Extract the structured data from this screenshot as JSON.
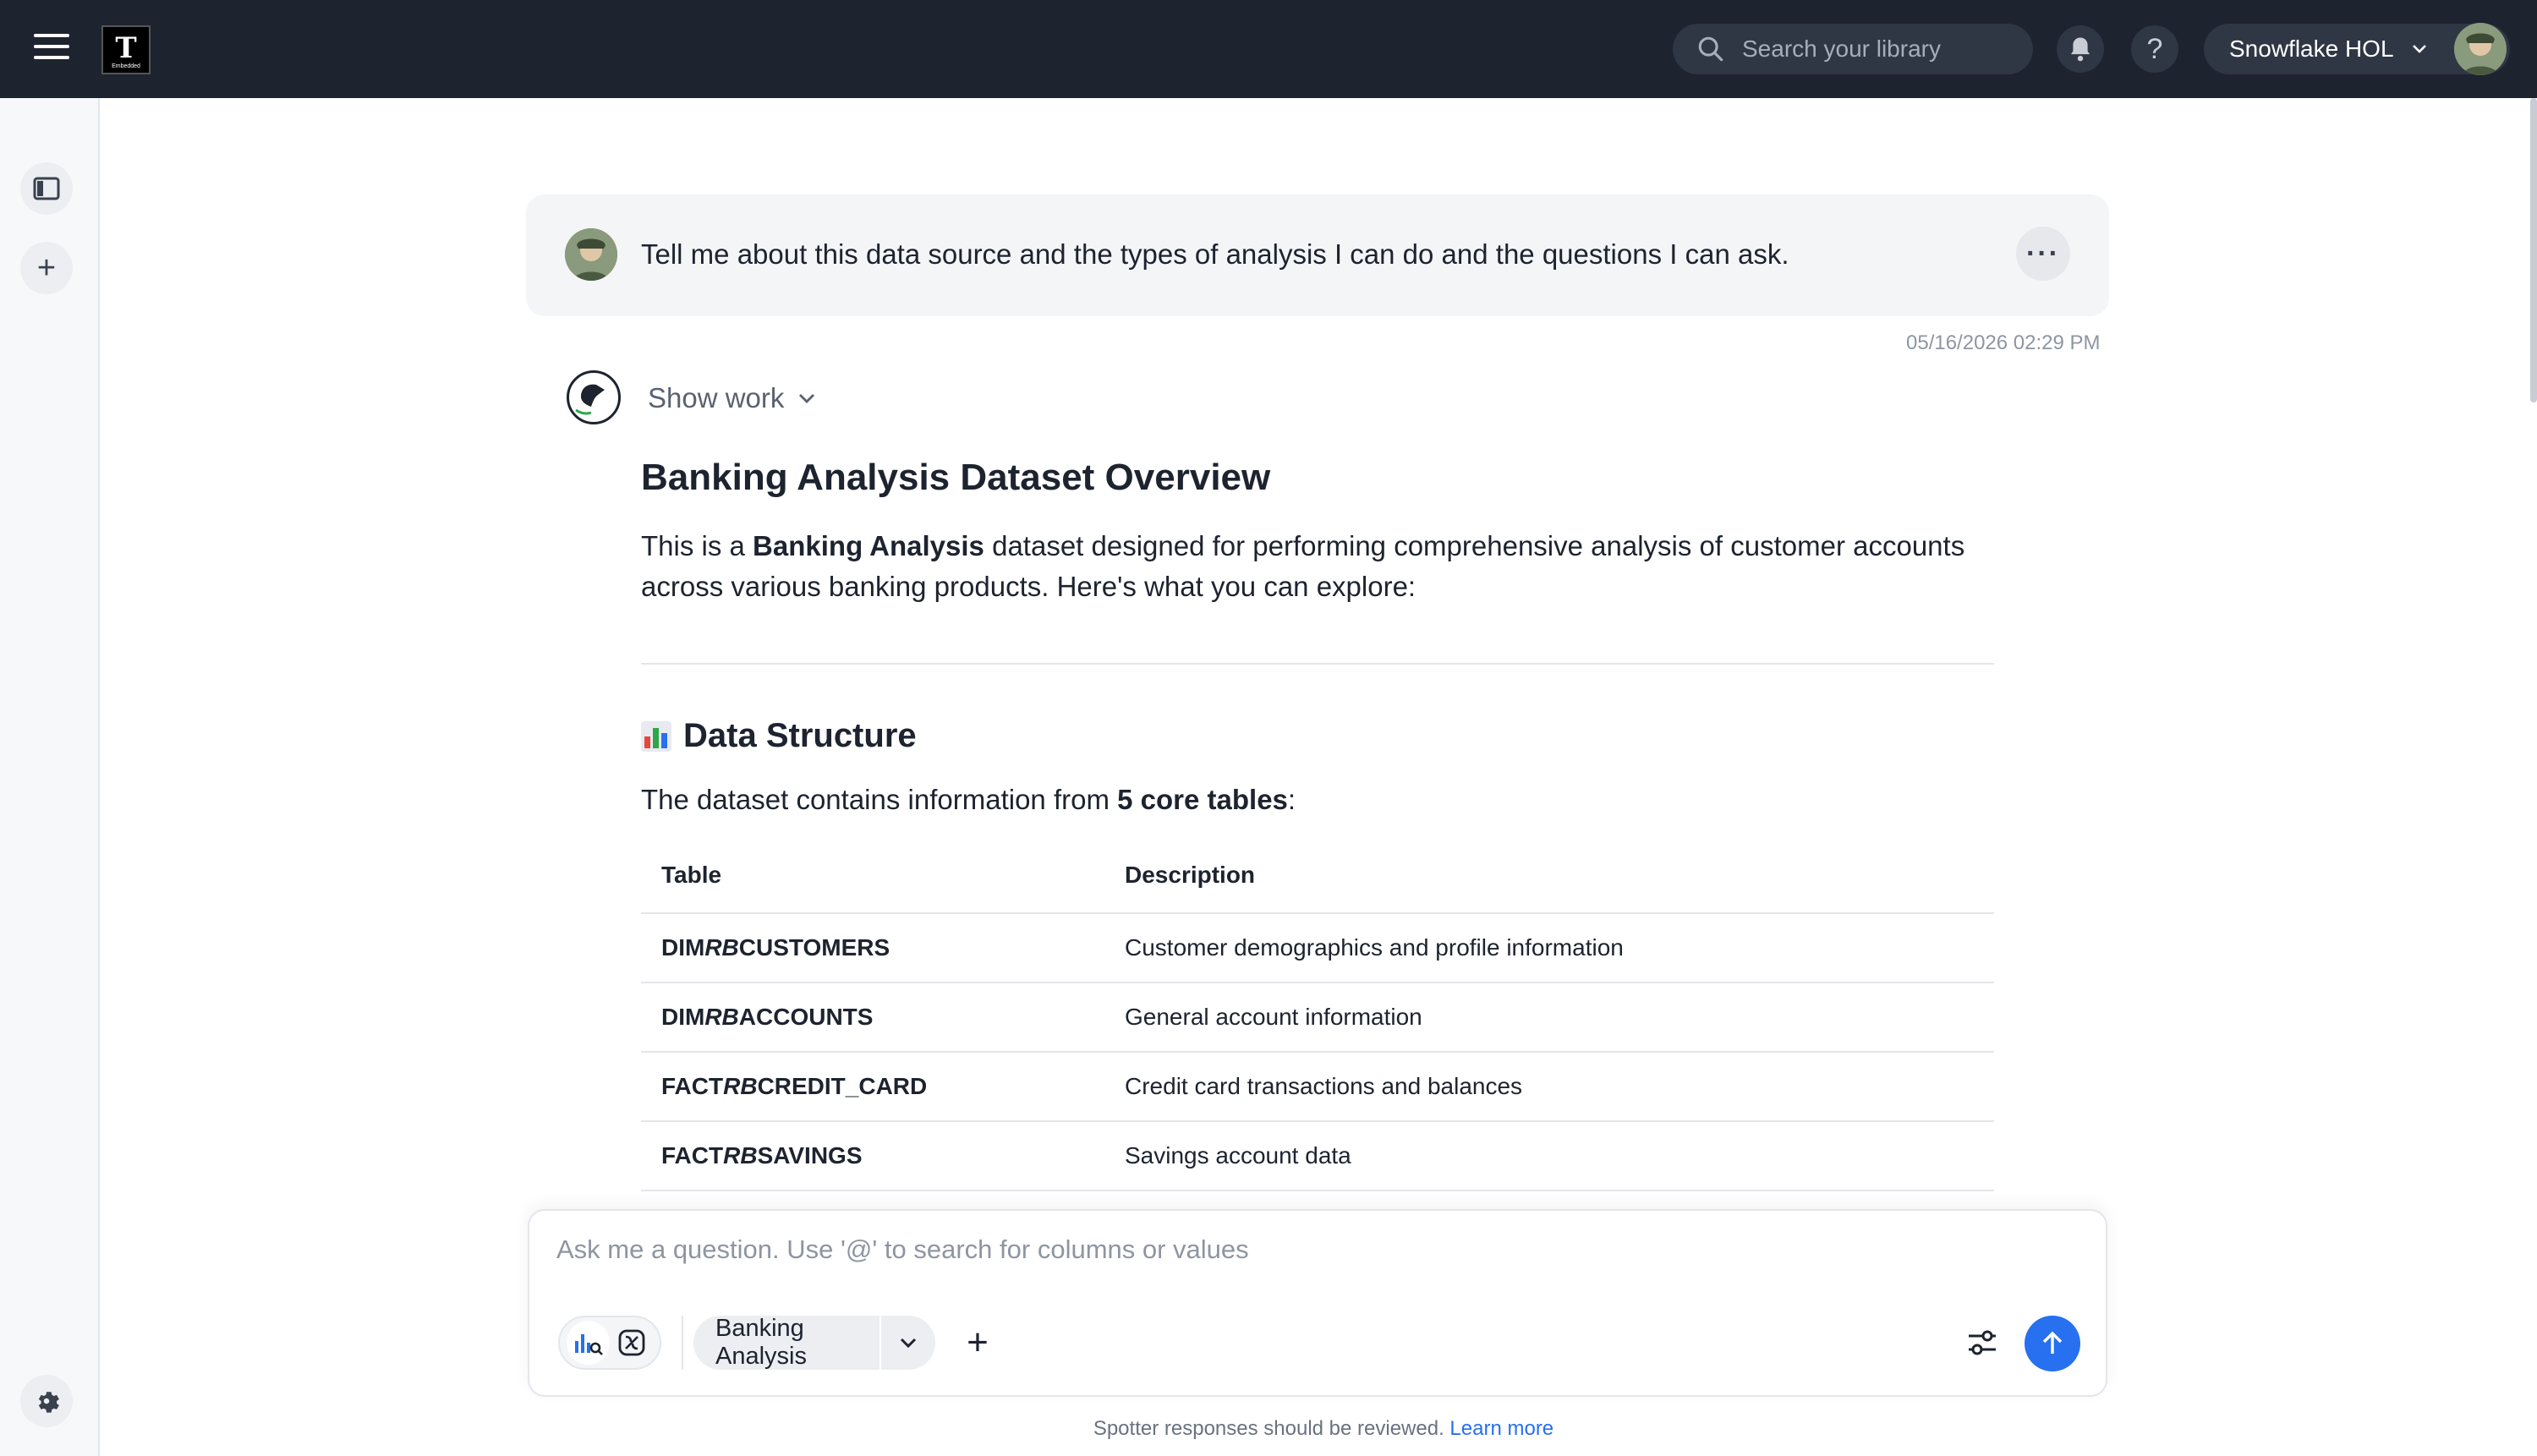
{
  "topbar": {
    "logo_letter": "T",
    "logo_caption": "Embedded",
    "search_placeholder": "Search your library",
    "org_name": "Snowflake HOL",
    "icons": [
      "menu-icon",
      "bell-icon",
      "help-icon",
      "chevron-down-icon"
    ]
  },
  "sidebar": {
    "icons": [
      "sidebar-toggle-icon",
      "plus-icon",
      "gear-icon"
    ]
  },
  "conversation": {
    "question": "Tell me about this data source and the types of analysis I can do and the questions I can ask.",
    "timestamp": "05/16/2026 02:29 PM",
    "show_work_label": "Show work",
    "response": {
      "title": "Banking Analysis Dataset Overview",
      "intro_prefix": "This is a ",
      "intro_bold": "Banking Analysis",
      "intro_suffix": " dataset designed for performing comprehensive analysis of customer accounts across various banking products. Here's what you can explore:",
      "section_title": "Data Structure",
      "sentence_prefix": "The dataset contains information from ",
      "sentence_bold": "5 core tables",
      "sentence_suffix": ":",
      "table": {
        "headers": [
          "Table",
          "Description"
        ],
        "rows": [
          {
            "pre": "DIM",
            "mid": "RB",
            "post": "CUSTOMERS",
            "description": "Customer demographics and profile information"
          },
          {
            "pre": "DIM",
            "mid": "RB",
            "post": "ACCOUNTS",
            "description": "General account information"
          },
          {
            "pre": "FACT",
            "mid": "RB",
            "post": "CREDIT_CARD",
            "description": "Credit card transactions and balances"
          },
          {
            "pre": "FACT",
            "mid": "RB",
            "post": "SAVINGS",
            "description": "Savings account data"
          }
        ]
      }
    }
  },
  "composer": {
    "placeholder": "Ask me a question. Use '@' to search for columns or values",
    "data_source": "Banking Analysis"
  },
  "footer": {
    "note": "Spotter responses should be reviewed.",
    "link": "Learn more"
  },
  "colors": {
    "topbar_bg": "#1d232f",
    "accent": "#2770ef",
    "card_bg": "#f4f5f7"
  }
}
